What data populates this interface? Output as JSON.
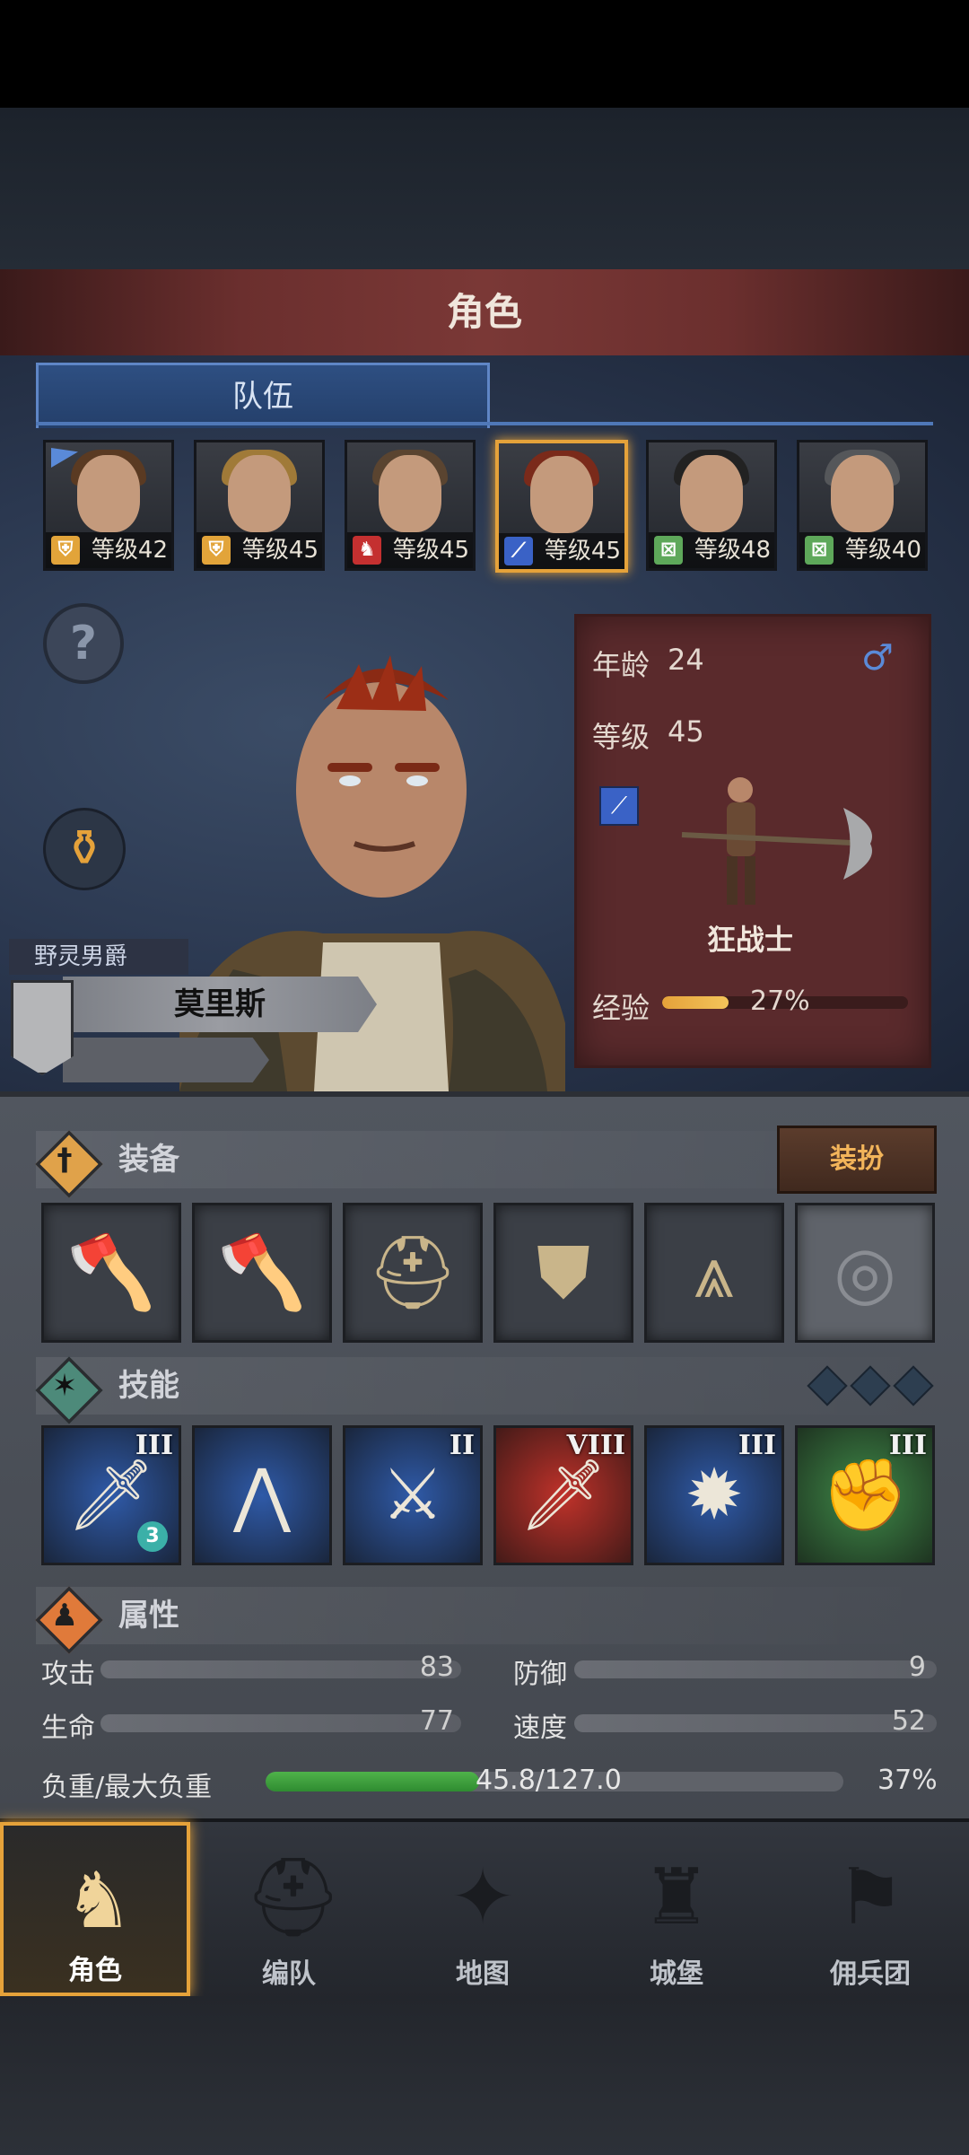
{
  "header": {
    "title": "角色"
  },
  "tabs": {
    "active": "队伍"
  },
  "roster": [
    {
      "level": "等级42",
      "class_icon": "shield-icon",
      "class_color": "#e2a43a",
      "hair": "#5a3a22",
      "flag": true
    },
    {
      "level": "等级45",
      "class_icon": "shield-icon",
      "class_color": "#e2a43a",
      "hair": "#a07a38"
    },
    {
      "level": "等级45",
      "class_icon": "horse-icon",
      "class_color": "#c43030",
      "hair": "#5a4430"
    },
    {
      "level": "等级45",
      "class_icon": "sword-icon",
      "class_color": "#3a62c6",
      "hair": "#7a2a1a",
      "selected": true
    },
    {
      "level": "等级48",
      "class_icon": "bow-icon",
      "class_color": "#5ea85a",
      "hair": "#222222"
    },
    {
      "level": "等级40",
      "class_icon": "bow-icon",
      "class_color": "#5ea85a",
      "hair": "#55575a"
    }
  ],
  "hero": {
    "title": "野灵男爵",
    "name": "莫里斯",
    "age_label": "年龄",
    "age": "24",
    "gender_symbol": "♂",
    "level_label": "等级",
    "level": "45",
    "class_name": "狂战士",
    "exp_label": "经验",
    "exp_percent_text": "27%",
    "exp_fraction": 0.27
  },
  "equipment": {
    "title": "装备",
    "dress_button": "装扮",
    "slots": [
      "axe-icon",
      "axe-icon",
      "helmet-icon",
      "armor-icon",
      "boots-icon",
      "ring-icon"
    ]
  },
  "skills": {
    "title": "技能",
    "items": [
      {
        "icon": "blood-sword-icon",
        "rank": "III",
        "color": "#2f5aa8",
        "badge": "3"
      },
      {
        "icon": "claw-icon",
        "rank": "",
        "color": "#2f5aa8"
      },
      {
        "icon": "double-sword-icon",
        "rank": "II",
        "color": "#2f5aa8"
      },
      {
        "icon": "great-sword-icon",
        "rank": "VIII",
        "color": "#c0322a"
      },
      {
        "icon": "shield-burst-icon",
        "rank": "III",
        "color": "#2f5aa8"
      },
      {
        "icon": "fist-icon",
        "rank": "III",
        "color": "#3f8a48"
      }
    ]
  },
  "attributes": {
    "title": "属性",
    "attack_label": "攻击",
    "attack": "83",
    "defense_label": "防御",
    "defense": "9",
    "hp_label": "生命",
    "hp": "77",
    "speed_label": "速度",
    "speed": "52",
    "load_label": "负重/最大负重",
    "load_text": "45.8/127.0",
    "load_percent": "37%",
    "load_fraction": 0.37
  },
  "nav": [
    {
      "label": "角色",
      "icon": "knight-icon",
      "active": true
    },
    {
      "label": "编队",
      "icon": "helmet-icon"
    },
    {
      "label": "地图",
      "icon": "compass-icon"
    },
    {
      "label": "城堡",
      "icon": "castle-icon"
    },
    {
      "label": "佣兵团",
      "icon": "banner-icon"
    }
  ]
}
